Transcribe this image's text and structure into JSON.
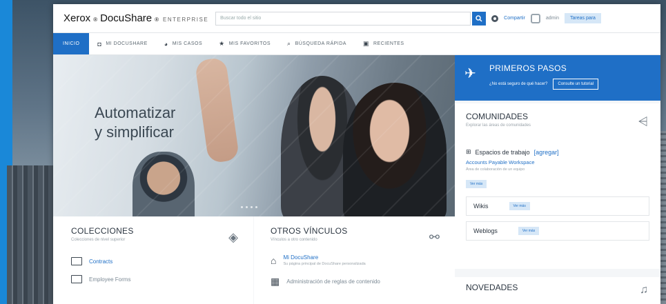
{
  "header": {
    "logo_text": "Xerox",
    "logo_product": "DocuShare",
    "logo_edition": "ENTERPRISE",
    "search_placeholder": "Buscar todo el sitio",
    "compartir": "Compartir",
    "user_label": "admin",
    "action_button": "Tareas para"
  },
  "nav": {
    "tabs": [
      {
        "label": "INICIO"
      },
      {
        "label": "MI DOCUSHARE"
      },
      {
        "label": "MIS CASOS"
      },
      {
        "label": "MIS FAVORITOS"
      },
      {
        "label": "BÚSQUEDA RÁPIDA"
      },
      {
        "label": "RECIENTES"
      }
    ]
  },
  "hero": {
    "title": "Automatizar\ny simplificar"
  },
  "colecciones": {
    "title": "COLECCIONES",
    "subtitle": "Colecciones de nivel superior",
    "items": [
      "Contracts",
      "Employee Forms"
    ]
  },
  "vinculos": {
    "title": "OTROS VÍNCULOS",
    "subtitle": "Vínculos a otro contenido",
    "items": [
      {
        "label": "Mi DocuShare",
        "desc": "Su página principal de DocuShare personalizada"
      },
      {
        "label": "Administración de reglas de contenido",
        "desc": ""
      }
    ]
  },
  "pasos": {
    "title": "PRIMEROS PASOS",
    "question": "¿No está seguro de qué hacer?",
    "button": "Consulte un tutorial"
  },
  "comunidades": {
    "title": "COMUNIDADES",
    "subtitle": "Explorar las áreas de comunidades",
    "workspace_label": "Espacios de trabajo",
    "workspace_add": "[agregar]",
    "workspace_link": "Accounts Payable Workspace",
    "workspace_desc": "Área de colaboración de un equipo",
    "tag": "Ver más",
    "wikis": "Wikis",
    "weblogs": "Weblogs"
  },
  "novedades": {
    "title": "NOVEDADES"
  },
  "colors": {
    "accent": "#1f6fc6"
  },
  "icons": [
    "search-icon",
    "gear-icon",
    "user-icon",
    "mydocushare-icon",
    "cases-icon",
    "favorites-icon",
    "quick-search-icon",
    "recent-icon",
    "layers-icon",
    "link-icon",
    "folder-icon",
    "home-icon",
    "paper-plane-icon",
    "share-icon",
    "workspace-icon",
    "bell-icon"
  ]
}
